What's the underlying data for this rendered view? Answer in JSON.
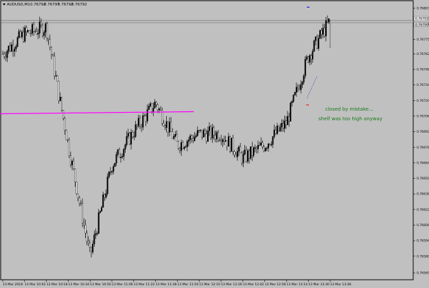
{
  "window": {
    "title": "AUDUSD,M1",
    "ohlc": [
      "0.76792",
      "0.76797",
      "0.76792",
      "0.76792"
    ]
  },
  "annotations": [
    {
      "text": "closed by mistake..."
    },
    {
      "text": "shelf was too high anyway"
    }
  ],
  "colors": {
    "background": "#c0c0c0",
    "candle": "#000000",
    "trendline": "#ff00ff",
    "annotation": "#1a7a1a",
    "horizontal_line": "#808080",
    "stop_marker": "#ff0000",
    "entry_marker": "#0000ff"
  },
  "chart_data": {
    "type": "candlestick",
    "instrument": "AUDUSD",
    "timeframe": "M1",
    "y_ticks": [
      "0.76803",
      "0.76789",
      "0.76775",
      "0.76762",
      "0.76748",
      "0.76734",
      "0.76720",
      "0.76706",
      "0.76692",
      "0.76678",
      "0.76664",
      "0.76650",
      "0.76636",
      "0.76622",
      "0.76608",
      "0.76594",
      "0.76580",
      "0.76565"
    ],
    "y_tick_values": [
      0.76803,
      0.76789,
      0.76775,
      0.76762,
      0.76748,
      0.76734,
      0.7672,
      0.76706,
      0.76692,
      0.76678,
      0.76664,
      0.7665,
      0.76636,
      0.76622,
      0.76608,
      0.76594,
      0.7658,
      0.76565
    ],
    "x_ticks": [
      "13 Mar 2018",
      "13 Mar 10:02",
      "13 Mar 10:18",
      "13 Mar 10:34",
      "13 Mar 10:50",
      "13 Mar 11:06",
      "13 Mar 11:22",
      "13 Mar 11:38",
      "13 Mar 11:54",
      "13 Mar 12:10",
      "13 Mar 12:26",
      "13 Mar 12:42",
      "13 Mar 12:58",
      "13 Mar 13:14",
      "13 Mar 13:30",
      "13 Mar 13:46"
    ],
    "price_labels": [
      "0.76792",
      "0.76790"
    ],
    "horizontal_lines": [
      0.76792,
      0.7679
    ],
    "trendline": {
      "from": [
        "13 Mar 12:10",
        0.7671
      ],
      "to": [
        "13 Mar 13:20",
        0.76708
      ]
    },
    "key_points": [
      {
        "time": "13 Mar 2018",
        "price": 0.76762
      },
      {
        "time": "13 Mar 10:02",
        "price": 0.7678
      },
      {
        "time": "13 Mar 10:18",
        "price": 0.76786
      },
      {
        "time": "13 Mar 10:34",
        "price": 0.7668
      },
      {
        "time": "13 Mar 10:50",
        "price": 0.7658
      },
      {
        "time": "13 Mar 11:06",
        "price": 0.76662
      },
      {
        "time": "13 Mar 11:22",
        "price": 0.76692
      },
      {
        "time": "13 Mar 11:38",
        "price": 0.76718
      },
      {
        "time": "13 Mar 11:54",
        "price": 0.7668
      },
      {
        "time": "13 Mar 12:10",
        "price": 0.7669
      },
      {
        "time": "13 Mar 12:26",
        "price": 0.7669
      },
      {
        "time": "13 Mar 12:42",
        "price": 0.76668
      },
      {
        "time": "13 Mar 12:58",
        "price": 0.7668
      },
      {
        "time": "13 Mar 13:14",
        "price": 0.767
      },
      {
        "time": "13 Mar 13:30",
        "price": 0.7676
      },
      {
        "time": "13 Mar 13:46",
        "price": 0.76792
      }
    ]
  }
}
